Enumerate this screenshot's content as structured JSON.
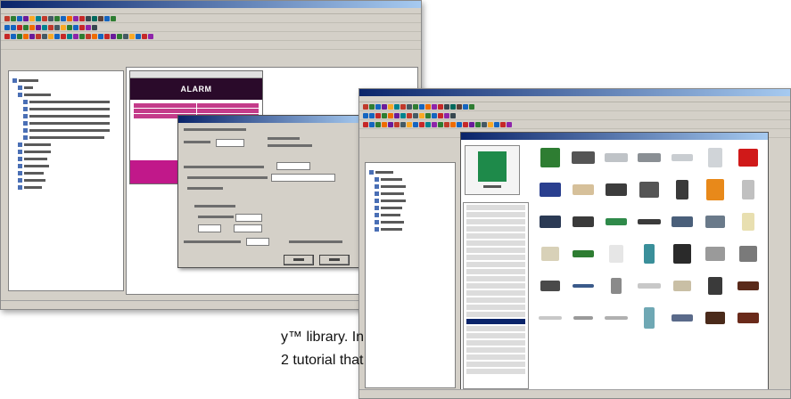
{
  "caption": {
    "line1": "y™ library.  In",
    "line2": "2 tutorial that"
  },
  "back_window": {
    "canvas_title": "ALARM",
    "toolbar_colors": [
      [
        "#c0392b",
        "#2e7d32",
        "#1565c0",
        "#6a1b9a",
        "#f9a825",
        "#00838f",
        "#c0392b",
        "#455a64",
        "#2e7d32",
        "#1565c0",
        "#ef6c00",
        "#8e24aa",
        "#c62828",
        "#37474f",
        "#00695c",
        "#5d4037",
        "#1565c0",
        "#2e7d32"
      ],
      [
        "#1565c0",
        "#1565c0",
        "#c62828",
        "#2e7d32",
        "#ef6c00",
        "#6a1b9a",
        "#00838f",
        "#c0392b",
        "#455a64",
        "#f9a825",
        "#2e7d32",
        "#1565c0",
        "#c62828",
        "#8e24aa",
        "#37474f"
      ],
      [
        "#c62828",
        "#1565c0",
        "#2e7d32",
        "#ef6c00",
        "#6a1b9a",
        "#c0392b",
        "#455a64",
        "#f9a825",
        "#1565c0",
        "#c62828",
        "#00838f",
        "#8e24aa",
        "#2e7d32",
        "#c0392b",
        "#ef6c00",
        "#1565c0",
        "#c62828",
        "#6a1b9a",
        "#2e7d32",
        "#455a64",
        "#f9a825",
        "#1565c0",
        "#c62828",
        "#8e24aa"
      ]
    ]
  },
  "front_window": {
    "library_shapes": [
      {
        "c": "#2e7d32",
        "w": 22,
        "h": 22
      },
      {
        "c": "#555555",
        "w": 26,
        "h": 14
      },
      {
        "c": "#bfc3c7",
        "w": 26,
        "h": 10
      },
      {
        "c": "#8a8f94",
        "w": 26,
        "h": 10
      },
      {
        "c": "#c9cdd1",
        "w": 24,
        "h": 8
      },
      {
        "c": "#d0d4d8",
        "w": 16,
        "h": 22
      },
      {
        "c": "#d01919",
        "w": 22,
        "h": 20
      },
      {
        "c": "#2a3f8f",
        "w": 24,
        "h": 16
      },
      {
        "c": "#d6c09a",
        "w": 24,
        "h": 12
      },
      {
        "c": "#3c3c3c",
        "w": 24,
        "h": 14
      },
      {
        "c": "#555555",
        "w": 22,
        "h": 18
      },
      {
        "c": "#3a3a3a",
        "w": 14,
        "h": 22
      },
      {
        "c": "#e8891a",
        "w": 20,
        "h": 24
      },
      {
        "c": "#c0c0c0",
        "w": 14,
        "h": 22
      },
      {
        "c": "#2b3a55",
        "w": 24,
        "h": 14
      },
      {
        "c": "#3a3a3a",
        "w": 24,
        "h": 12
      },
      {
        "c": "#2f8a4a",
        "w": 24,
        "h": 8
      },
      {
        "c": "#3b3b3b",
        "w": 26,
        "h": 6
      },
      {
        "c": "#4a5f7a",
        "w": 24,
        "h": 12
      },
      {
        "c": "#6a7a8a",
        "w": 22,
        "h": 14
      },
      {
        "c": "#e8dfb0",
        "w": 14,
        "h": 20
      },
      {
        "c": "#d8d1b8",
        "w": 20,
        "h": 16
      },
      {
        "c": "#2e7d32",
        "w": 24,
        "h": 8
      },
      {
        "c": "#e6e6e6",
        "w": 16,
        "h": 20
      },
      {
        "c": "#3a8f9a",
        "w": 12,
        "h": 22
      },
      {
        "c": "#2a2a2a",
        "w": 20,
        "h": 22
      },
      {
        "c": "#9a9a9a",
        "w": 22,
        "h": 16
      },
      {
        "c": "#7a7a7a",
        "w": 20,
        "h": 18
      },
      {
        "c": "#4a4a4a",
        "w": 22,
        "h": 12
      },
      {
        "c": "#3a5a8a",
        "w": 24,
        "h": 4
      },
      {
        "c": "#8a8a8a",
        "w": 12,
        "h": 18
      },
      {
        "c": "#c8c8c8",
        "w": 26,
        "h": 6
      },
      {
        "c": "#c9bfa5",
        "w": 20,
        "h": 12
      },
      {
        "c": "#3a3a3a",
        "w": 16,
        "h": 20
      },
      {
        "c": "#5a2a1a",
        "w": 24,
        "h": 10
      },
      {
        "c": "#c8c8c8",
        "w": 26,
        "h": 4
      },
      {
        "c": "#9a9a9a",
        "w": 22,
        "h": 4
      },
      {
        "c": "#b0b0b0",
        "w": 26,
        "h": 4
      },
      {
        "c": "#6fa8b4",
        "w": 12,
        "h": 24
      },
      {
        "c": "#5a6a8a",
        "w": 24,
        "h": 8
      },
      {
        "c": "#4a2a1a",
        "w": 22,
        "h": 14
      },
      {
        "c": "#6a2a1a",
        "w": 24,
        "h": 12
      }
    ]
  }
}
